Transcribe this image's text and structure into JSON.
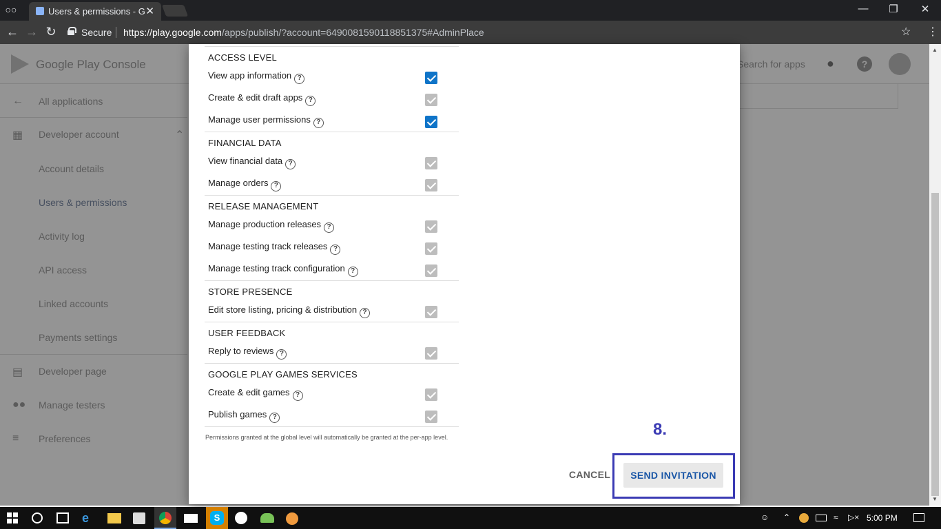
{
  "browser": {
    "tab_title": "Users & permissions - Google Play Console",
    "secure_label": "Secure",
    "url_host": "https://play.google.com",
    "url_path": "/apps/publish/?account=6490081590118851375#AdminPlace"
  },
  "console": {
    "logo_text": "Google Play Console",
    "search_placeholder": "Search for apps",
    "sidebar": {
      "all_applications": "All applications",
      "developer_account": "Developer account",
      "account_details": "Account details",
      "users_permissions": "Users & permissions",
      "activity_log": "Activity log",
      "api_access": "API access",
      "linked_accounts": "Linked accounts",
      "payments_settings": "Payments settings",
      "developer_page": "Developer page",
      "manage_testers": "Manage testers",
      "preferences": "Preferences"
    }
  },
  "dialog": {
    "sections": [
      {
        "title": "ACCESS LEVEL",
        "items": [
          {
            "label": "View app information",
            "checked": true,
            "enabled": true
          },
          {
            "label": "Create & edit draft apps",
            "checked": true,
            "enabled": false
          },
          {
            "label": "Manage user permissions",
            "checked": true,
            "enabled": true
          }
        ]
      },
      {
        "title": "FINANCIAL DATA",
        "items": [
          {
            "label": "View financial data",
            "checked": true,
            "enabled": false
          },
          {
            "label": "Manage orders",
            "checked": true,
            "enabled": false
          }
        ]
      },
      {
        "title": "RELEASE MANAGEMENT",
        "items": [
          {
            "label": "Manage production releases",
            "checked": true,
            "enabled": false
          },
          {
            "label": "Manage testing track releases",
            "checked": true,
            "enabled": false
          },
          {
            "label": "Manage testing track configuration",
            "checked": true,
            "enabled": false
          }
        ]
      },
      {
        "title": "STORE PRESENCE",
        "items": [
          {
            "label": "Edit store listing, pricing & distribution",
            "checked": true,
            "enabled": false
          }
        ]
      },
      {
        "title": "USER FEEDBACK",
        "items": [
          {
            "label": "Reply to reviews",
            "checked": true,
            "enabled": false
          }
        ]
      },
      {
        "title": "GOOGLE PLAY GAMES SERVICES",
        "items": [
          {
            "label": "Create & edit games",
            "checked": true,
            "enabled": false
          },
          {
            "label": "Publish games",
            "checked": true,
            "enabled": false
          }
        ]
      }
    ],
    "footnote": "Permissions granted at the global level will automatically be granted at the per-app level.",
    "cancel_label": "CANCEL",
    "send_label": "SEND INVITATION",
    "annotation_step": "8."
  },
  "taskbar": {
    "time": "5:00 PM"
  },
  "colors": {
    "checkbox_on": "#0f74c8",
    "checkbox_disabled": "#bdbdbd",
    "annotation": "#3b3bb4"
  }
}
